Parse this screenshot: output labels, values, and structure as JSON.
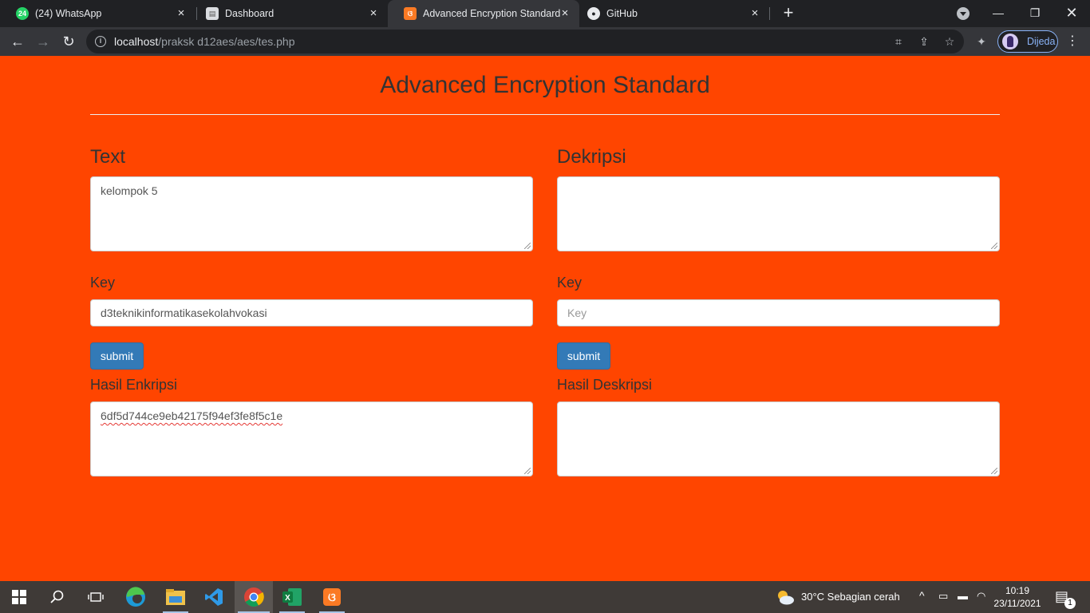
{
  "browser": {
    "tabs": [
      {
        "label": "(24) WhatsApp",
        "badge": "24"
      },
      {
        "label": "Dashboard"
      },
      {
        "label": "Advanced Encryption Standard"
      },
      {
        "label": "GitHub"
      }
    ],
    "url_host": "localhost",
    "url_path": "/praksk d12aes/aes/tes.php",
    "profile_name": "Dijeda"
  },
  "page": {
    "title": "Advanced Encryption Standard",
    "left": {
      "heading": "Text",
      "text_value": "kelompok 5",
      "key_label": "Key",
      "key_value": "d3teknikinformatikasekolahvokasi",
      "submit_label": "submit",
      "result_label": "Hasil Enkripsi",
      "result_value": "6df5d744ce9eb42175f94ef3fe8f5c1e"
    },
    "right": {
      "heading": "Dekripsi",
      "text_value": "",
      "key_label": "Key",
      "key_placeholder": "Key",
      "submit_label": "submit",
      "result_label": "Hasil Deskripsi",
      "result_value": ""
    }
  },
  "taskbar": {
    "weather": "30°C  Sebagian cerah",
    "time": "10:19",
    "date": "23/11/2021",
    "notifications": "1"
  },
  "colors": {
    "page_bg": "#ff4500",
    "button_bg": "#337ab7"
  }
}
